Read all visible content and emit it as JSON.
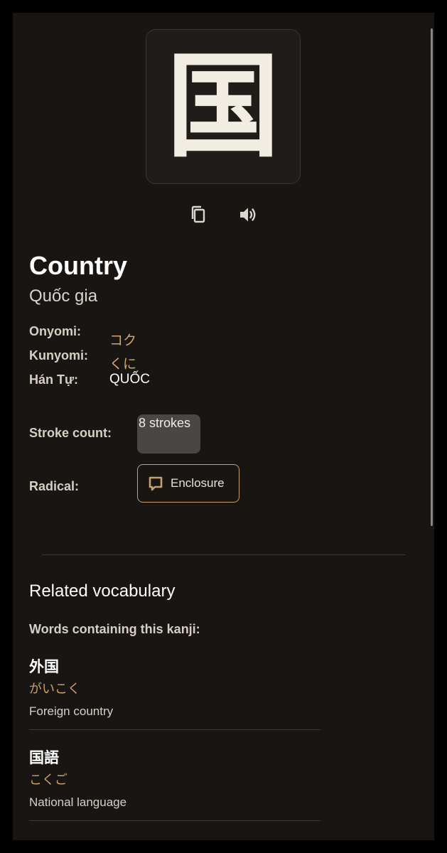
{
  "kanji": {
    "character": "国"
  },
  "actions": {
    "copy_icon": "copy-icon",
    "sound_icon": "speaker-icon"
  },
  "meaning": {
    "english": "Country",
    "vietnamese": "Quốc gia"
  },
  "readings": {
    "onyomi_label": "Onyomi:",
    "onyomi_value": "コク",
    "kunyomi_label": "Kunyomi:",
    "kunyomi_value": "くに",
    "hantu_label": "Hán Tự:",
    "hantu_value": "QUỐC"
  },
  "stroke": {
    "label": "Stroke count:",
    "value": "8 strokes"
  },
  "radical": {
    "label": "Radical:",
    "value": "Enclosure",
    "icon": "enclosure-icon"
  },
  "vocabulary": {
    "title": "Related vocabulary",
    "subtitle": "Words containing this kanji:",
    "items": [
      {
        "word": "外国",
        "reading": "がいこく",
        "meaning": "Foreign country"
      },
      {
        "word": "国語",
        "reading": "こくご",
        "meaning": "National language"
      }
    ]
  },
  "colors": {
    "background": "#181512",
    "accent_gold": "#d3a870",
    "chip_gray": "#4a4643"
  }
}
